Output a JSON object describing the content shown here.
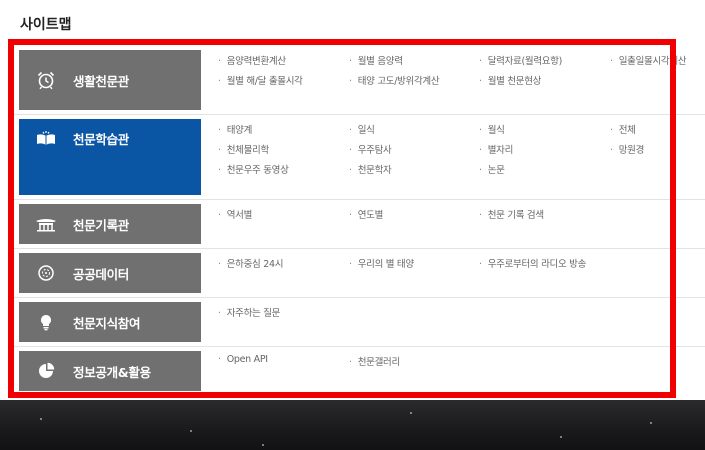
{
  "title": "사이트맵",
  "categories": [
    {
      "label": "생활천문관",
      "icon": "alarm-clock-icon",
      "links": [
        "음양력변환계산",
        "월별 음양력",
        "달력자료(월력요항)",
        "일출일몰시각계산",
        "월별 해/달 출몰시각",
        "태양 고도/방위각계산",
        "월별 천문현상"
      ]
    },
    {
      "label": "천문학습관",
      "icon": "open-book-icon",
      "links": [
        "태양계",
        "일식",
        "월식",
        "전체",
        "천체물리학",
        "우주탐사",
        "별자리",
        "망원경",
        "천문우주 동영상",
        "천문학자",
        "논문"
      ]
    },
    {
      "label": "천문기록관",
      "icon": "palace-icon",
      "links": [
        "역서별",
        "연도별",
        "천문 기록 검색"
      ]
    },
    {
      "label": "공공데이터",
      "icon": "globe-icon",
      "links": [
        "은하중심 24시",
        "우리의 별 태양",
        "우주로부터의 라디오 방송"
      ]
    },
    {
      "label": "천문지식참여",
      "icon": "lightbulb-icon",
      "links": [
        "자주하는 질문"
      ]
    },
    {
      "label": "정보공개&활용",
      "icon": "pie-chart-icon",
      "links": [
        "Open API",
        "천문갤러리"
      ]
    }
  ],
  "colors": {
    "category_bg": "#707070",
    "active_bg": "#0b55a5",
    "highlight": "#f00000"
  }
}
